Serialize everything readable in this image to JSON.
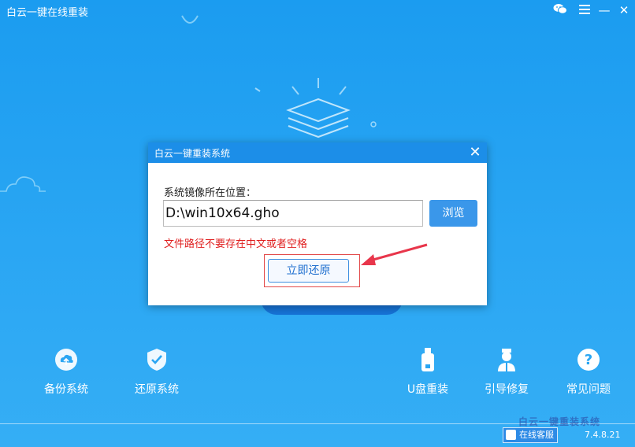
{
  "app": {
    "title": "白云一键在线重装",
    "controls": {
      "chat_icon": "wechat-icon",
      "menu_icon": "menu-icon",
      "minimize": "—",
      "close": "✕"
    }
  },
  "features_left": [
    {
      "label": "备份系统",
      "icon": "cloud-upload-icon"
    },
    {
      "label": "还原系统",
      "icon": "shield-check-icon"
    }
  ],
  "features_right": [
    {
      "label": "U盘重装",
      "icon": "usb-drive-icon"
    },
    {
      "label": "引导修复",
      "icon": "technician-icon"
    },
    {
      "label": "常见问题",
      "icon": "question-icon"
    }
  ],
  "dialog": {
    "title": "白云一键重装系统",
    "close": "✕",
    "label": "系统镜像所在位置：",
    "path_value": "D:\\win10x64.gho",
    "browse_label": "浏览",
    "warning": "文件路径不要存在中文或者空格",
    "restore_label": "立即还原"
  },
  "footer": {
    "support_label": "在线客服",
    "version": "7.4.8.21"
  },
  "colors": {
    "background": "#1b9cf0",
    "dialog_header": "#1c8ee8",
    "warning": "#e02020",
    "highlight": "#e24a4a",
    "primary_button": "#3a97ea"
  }
}
